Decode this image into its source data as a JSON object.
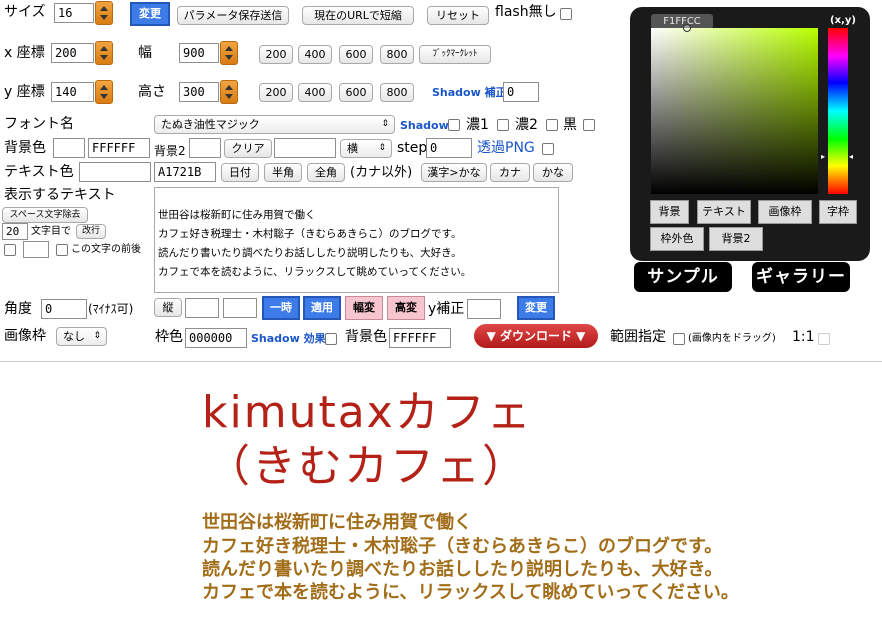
{
  "row1": {
    "size_label": "サイズ",
    "size_value": "16",
    "change_button": "変更",
    "save_params_button": "パラメータ保存送信",
    "shorten_url_button": "現在のURLで短縮",
    "reset_button": "リセット",
    "flash_label": "flash無し"
  },
  "row2": {
    "x_label": "x 座標",
    "x_value": "200",
    "width_label": "幅",
    "width_value": "900",
    "preset_buttons": [
      "200",
      "400",
      "600",
      "800"
    ],
    "bookmarklet_button": "ﾌﾞｯｸﾏｰｸﾚｯﾄ"
  },
  "row3": {
    "y_label": "y 座標",
    "y_value": "140",
    "height_label": "高さ",
    "height_value": "300",
    "preset_buttons": [
      "200",
      "400",
      "600",
      "800"
    ],
    "shadow_offset_label": "Shadow 補正",
    "shadow_offset_value": "0"
  },
  "font_row": {
    "font_label": "フォント名",
    "font_select": "たぬき油性マジック",
    "shadow_label": "Shadow",
    "dark1_label": "濃1",
    "dark2_label": "濃2",
    "black_label": "黒"
  },
  "bg_row": {
    "bg_label": "背景色",
    "bg_value": "FFFFFF",
    "bg2_label": "背景2",
    "clear_button": "クリア",
    "direction_select": "横",
    "step_label": "step",
    "step_value": "0",
    "transparent_label": "透過PNG"
  },
  "text_color_row": {
    "label": "テキスト色",
    "value": "A1721B",
    "buttons": [
      "日付",
      "半角",
      "全角"
    ],
    "kana_label": "(カナ以外)",
    "kanji_button": "漢字>かな",
    "kana_button": "カナ",
    "hira_button": "かな"
  },
  "display_text": {
    "label": "表示するテキスト",
    "remove_spaces_button": "スペース文字除去",
    "wrap_value": "20",
    "wrap_label": "文字目で",
    "wrap_button": "改行",
    "before_char_label": "この文字の前後",
    "text": "世田谷は桜新町に住み用賀で働く\nカフェ好き税理士・木村聡子（きむらあきらこ）のブログです。\n読んだり書いたり調べたりお話ししたり説明したりも、大好き。\nカフェで本を読むように、リラックスして眺めていってください。"
  },
  "angle_row": {
    "angle_label": "角度",
    "angle_value": "0",
    "minus_label": "(ﾏｲﾅｽ可)",
    "vertical_button": "縦",
    "pause_button": "一時",
    "apply_button": "適用",
    "width_change_button": "幅変",
    "height_change_button": "高変",
    "y_offset_label": "y補正",
    "change_button": "変更"
  },
  "frame_row": {
    "frame_label": "画像枠",
    "frame_select": "なし",
    "frame_color_label": "枠色",
    "frame_color_value": "000000",
    "shadow_effect_label": "Shadow 効果",
    "bg_color_label": "背景色",
    "bg_color_value": "FFFFFF",
    "download_button": "▼ ダウンロード ▼",
    "range_label": "範囲指定",
    "drag_label": "(画像内をドラッグ)",
    "one_to_one_label": "1:1"
  },
  "picker": {
    "hex_value": "F1FFCC",
    "xy_label": "(x,y)",
    "buttons_row1": [
      "背景",
      "テキスト",
      "画像枠",
      "字枠"
    ],
    "buttons_row2": [
      "枠外色",
      "背景2"
    ]
  },
  "sample_button": "サンプル",
  "gallery_button": "ギャラリー",
  "canvas": {
    "title_line1": "kimutaxカフェ",
    "title_line2": "（きむカフェ）",
    "body_lines": [
      "世田谷は桜新町に住み用賀で働く",
      "カフェ好き税理士・木村聡子（きむらあきらこ）のブログです。",
      "読んだり書いたり調べたりお話ししたり説明したりも、大好き。",
      "カフェで本を読むように、リラックスして眺めていってください。"
    ],
    "title_color": "#b32117",
    "body_color": "#a26d18"
  }
}
